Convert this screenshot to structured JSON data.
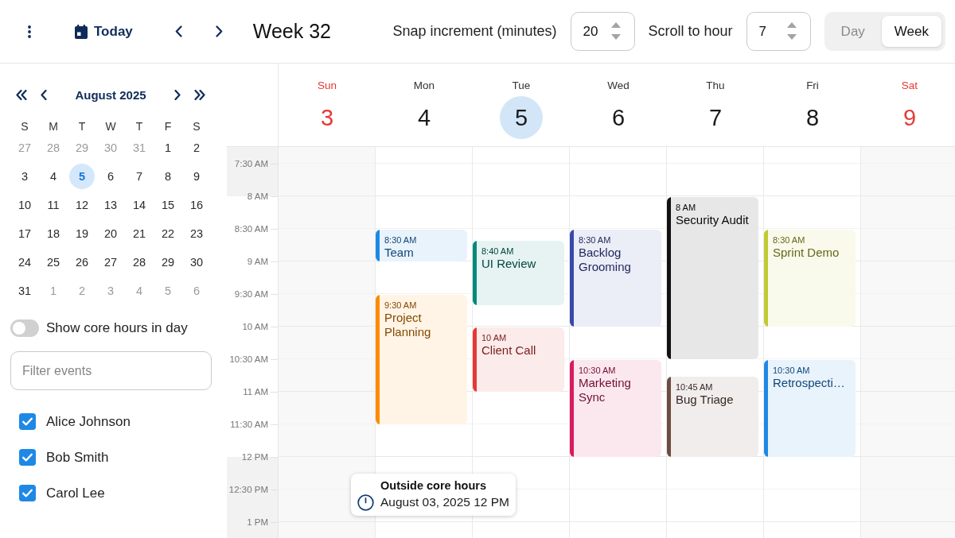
{
  "toolbar": {
    "today_button": "Today",
    "title": "Week 32",
    "snap_increment": {
      "label": "Snap increment (minutes)",
      "value": "20"
    },
    "scroll_to_hour": {
      "label": "Scroll to hour",
      "value": "7"
    },
    "view_tabs": [
      {
        "label": "Day",
        "selected": false
      },
      {
        "label": "Week",
        "selected": true
      }
    ]
  },
  "mini_calendar": {
    "title": "August 2025",
    "weekdays": [
      "S",
      "M",
      "T",
      "W",
      "T",
      "F",
      "S"
    ],
    "weeks": [
      [
        {
          "day": "27",
          "outside": true,
          "selected": false
        },
        {
          "day": "28",
          "outside": true,
          "selected": false
        },
        {
          "day": "29",
          "outside": true,
          "selected": false
        },
        {
          "day": "30",
          "outside": true,
          "selected": false
        },
        {
          "day": "31",
          "outside": true,
          "selected": false
        },
        {
          "day": "1",
          "outside": false,
          "selected": false
        },
        {
          "day": "2",
          "outside": false,
          "selected": false
        }
      ],
      [
        {
          "day": "3",
          "outside": false,
          "selected": false
        },
        {
          "day": "4",
          "outside": false,
          "selected": false
        },
        {
          "day": "5",
          "outside": false,
          "selected": true
        },
        {
          "day": "6",
          "outside": false,
          "selected": false
        },
        {
          "day": "7",
          "outside": false,
          "selected": false
        },
        {
          "day": "8",
          "outside": false,
          "selected": false
        },
        {
          "day": "9",
          "outside": false,
          "selected": false
        }
      ],
      [
        {
          "day": "10",
          "outside": false,
          "selected": false
        },
        {
          "day": "11",
          "outside": false,
          "selected": false
        },
        {
          "day": "12",
          "outside": false,
          "selected": false
        },
        {
          "day": "13",
          "outside": false,
          "selected": false
        },
        {
          "day": "14",
          "outside": false,
          "selected": false
        },
        {
          "day": "15",
          "outside": false,
          "selected": false
        },
        {
          "day": "16",
          "outside": false,
          "selected": false
        }
      ],
      [
        {
          "day": "17",
          "outside": false,
          "selected": false
        },
        {
          "day": "18",
          "outside": false,
          "selected": false
        },
        {
          "day": "19",
          "outside": false,
          "selected": false
        },
        {
          "day": "20",
          "outside": false,
          "selected": false
        },
        {
          "day": "21",
          "outside": false,
          "selected": false
        },
        {
          "day": "22",
          "outside": false,
          "selected": false
        },
        {
          "day": "23",
          "outside": false,
          "selected": false
        }
      ],
      [
        {
          "day": "24",
          "outside": false,
          "selected": false
        },
        {
          "day": "25",
          "outside": false,
          "selected": false
        },
        {
          "day": "26",
          "outside": false,
          "selected": false
        },
        {
          "day": "27",
          "outside": false,
          "selected": false
        },
        {
          "day": "28",
          "outside": false,
          "selected": false
        },
        {
          "day": "29",
          "outside": false,
          "selected": false
        },
        {
          "day": "30",
          "outside": false,
          "selected": false
        }
      ],
      [
        {
          "day": "31",
          "outside": false,
          "selected": false
        },
        {
          "day": "1",
          "outside": true,
          "selected": false
        },
        {
          "day": "2",
          "outside": true,
          "selected": false
        },
        {
          "day": "3",
          "outside": true,
          "selected": false
        },
        {
          "day": "4",
          "outside": true,
          "selected": false
        },
        {
          "day": "5",
          "outside": true,
          "selected": false
        },
        {
          "day": "6",
          "outside": true,
          "selected": false
        }
      ]
    ]
  },
  "core_hours_toggle": {
    "label": "Show core hours in day",
    "on": false
  },
  "filter": {
    "placeholder": "Filter events"
  },
  "people": [
    {
      "name": "Alice Johnson",
      "checked": true
    },
    {
      "name": "Bob Smith",
      "checked": true
    },
    {
      "name": "Carol Lee",
      "checked": true
    }
  ],
  "week": {
    "days": [
      {
        "name": "Sun",
        "date": "3",
        "weekend": true,
        "today": false
      },
      {
        "name": "Mon",
        "date": "4",
        "weekend": false,
        "today": false,
        "events": [
          {
            "time": "8:30 AM",
            "title": "Team",
            "color": "#1e88e5"
          },
          {
            "time": "9:30 AM",
            "title": "Project Planning",
            "color": "#fb8c00"
          }
        ]
      },
      {
        "name": "Tue",
        "date": "5",
        "weekend": false,
        "today": true,
        "events": [
          {
            "time": "8:40 AM",
            "title": "UI Review",
            "color": "#00897b"
          },
          {
            "time": "10 AM",
            "title": "Client Call",
            "color": "#e53935"
          }
        ]
      },
      {
        "name": "Wed",
        "date": "6",
        "weekend": false,
        "today": false,
        "events": [
          {
            "time": "8:30 AM",
            "title": "Backlog Grooming",
            "color": "#3949ab"
          },
          {
            "time": "10:30 AM",
            "title": "Marketing Sync",
            "color": "#d81b60"
          }
        ]
      },
      {
        "name": "Thu",
        "date": "7",
        "weekend": false,
        "today": false,
        "events": [
          {
            "time": "8 AM",
            "title": "Security Audit",
            "color": "#111111"
          },
          {
            "time": "10:45 AM",
            "title": "Bug Triage",
            "color": "#6d4c41"
          }
        ]
      },
      {
        "name": "Fri",
        "date": "8",
        "weekend": false,
        "today": false,
        "events": [
          {
            "time": "8:30 AM",
            "title": "Sprint Demo",
            "color": "#c0ca33"
          },
          {
            "time": "10:30 AM",
            "title": "Retrospecti…",
            "color": "#1e88e5"
          }
        ]
      },
      {
        "name": "Sat",
        "date": "9",
        "weekend": true,
        "today": false
      }
    ],
    "time_slots": [
      {
        "label": "7:30 AM",
        "core": false
      },
      {
        "label": "8 AM",
        "core": true
      },
      {
        "label": "8:30 AM",
        "core": true
      },
      {
        "label": "9 AM",
        "core": true
      },
      {
        "label": "9:30 AM",
        "core": true
      },
      {
        "label": "10 AM",
        "core": true
      },
      {
        "label": "10:30 AM",
        "core": true
      },
      {
        "label": "11 AM",
        "core": true
      },
      {
        "label": "11:30 AM",
        "core": true
      },
      {
        "label": "12 PM",
        "core": false
      },
      {
        "label": "12:30 PM",
        "core": false
      },
      {
        "label": "1 PM",
        "core": false
      }
    ]
  },
  "tooltip": {
    "title": "Outside core hours",
    "text": "August 03, 2025 12 PM"
  }
}
